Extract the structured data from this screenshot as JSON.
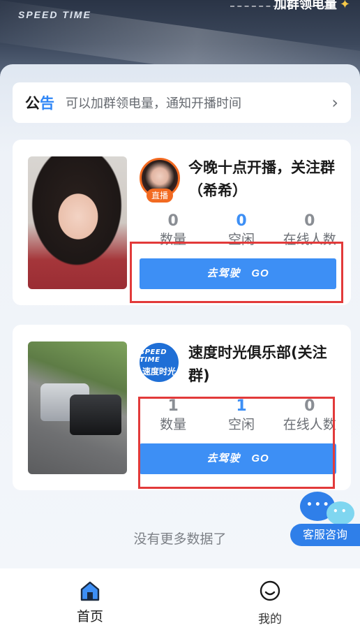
{
  "banner": {
    "logo_text": "SPEED TIME",
    "right_text": "加群领电量",
    "star": "✦"
  },
  "notice": {
    "tag_part1": "公",
    "tag_part2": "告",
    "text": "可以加群领电量，通知开播时间",
    "arrow": "›"
  },
  "cards": [
    {
      "title": "今晚十点开播，关注群（希希）",
      "badge": "直播",
      "stats": [
        {
          "value": "0",
          "label": "数量"
        },
        {
          "value": "0",
          "label": "空闲"
        },
        {
          "value": "0",
          "label": "在线人数"
        }
      ],
      "button_label": "去驾驶　GO"
    },
    {
      "title": "速度时光俱乐部(关注群)",
      "logo_en": "SPEED TIME",
      "logo_cn": "速度时光",
      "stats": [
        {
          "value": "1",
          "label": "数量"
        },
        {
          "value": "1",
          "label": "空闲"
        },
        {
          "value": "0",
          "label": "在线人数"
        }
      ],
      "button_label": "去驾驶　GO"
    }
  ],
  "footer_text": "没有更多数据了",
  "service_label": "客服咨询",
  "tabs": [
    {
      "label": "首页",
      "icon": "home-icon"
    },
    {
      "label": "我的",
      "icon": "smile-icon"
    }
  ],
  "colors": {
    "accent": "#3d8ff5",
    "live_badge": "#f26a21",
    "highlight_box": "#e23a3a"
  }
}
